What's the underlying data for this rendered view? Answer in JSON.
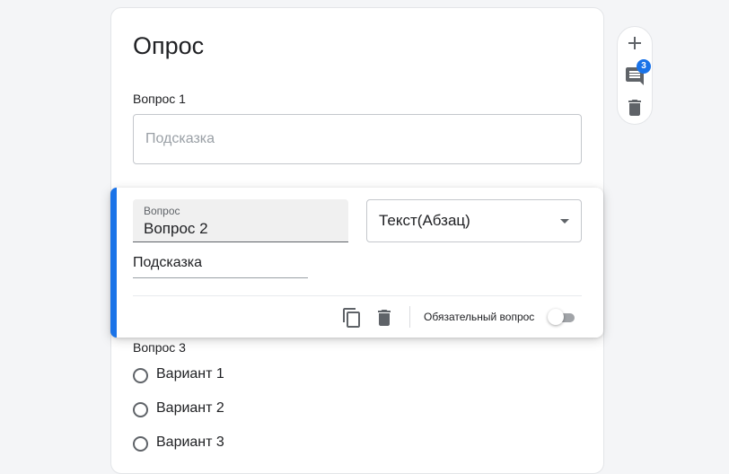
{
  "form": {
    "title": "Опрос",
    "question1": {
      "label": "Вопрос 1",
      "hint_placeholder": "Подсказка"
    },
    "active_question": {
      "field_label": "Вопрос",
      "value": "Вопрос 2",
      "type": "Текст(Абзац)",
      "hint": "Подсказка",
      "required_label": "Обязательный вопрос",
      "required": false
    },
    "question3": {
      "label": "Вопрос 3",
      "options": [
        "Вариант 1",
        "Вариант 2",
        "Вариант 3"
      ]
    }
  },
  "side_toolbar": {
    "comments_count": "3"
  },
  "colors": {
    "accent": "#1a73e8"
  },
  "icons": [
    "add-icon",
    "comment-icon",
    "trash-icon",
    "copy-icon",
    "chevron-down-icon"
  ]
}
